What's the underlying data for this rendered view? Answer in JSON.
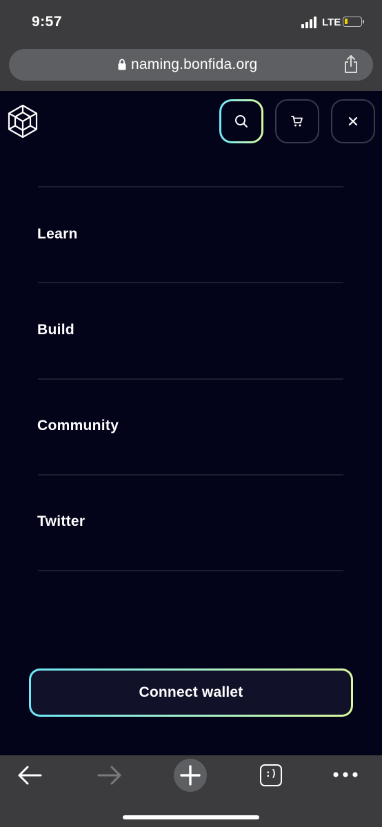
{
  "status_bar": {
    "time": "9:57",
    "network": "LTE",
    "signal_bars": 4,
    "battery_level": 0.2,
    "battery_color": "#f5d000"
  },
  "browser": {
    "url": "naming.bonfida.org",
    "lock_icon": "lock-icon",
    "share_icon": "share-icon"
  },
  "header": {
    "logo_icon": "cube-logo-icon",
    "search_icon": "search-icon",
    "cart_icon": "cart-icon",
    "close_icon": "close-icon",
    "accent_gradient": [
      "#6ee7f7",
      "#d9f99d"
    ]
  },
  "menu": {
    "items": [
      {
        "label": "Learn"
      },
      {
        "label": "Build"
      },
      {
        "label": "Community"
      },
      {
        "label": "Twitter"
      }
    ]
  },
  "connect_wallet": {
    "label": "Connect wallet"
  },
  "toolbar": {
    "back_icon": "back-arrow-icon",
    "forward_icon": "forward-arrow-icon",
    "new_tab_icon": "plus-icon",
    "tabs_icon": "tabs-smiley-icon",
    "tabs_label": ":)",
    "more_icon": "more-dots-icon"
  },
  "colors": {
    "background": "#03031a",
    "chrome": "#3c3c3e",
    "divider": "#1d1e30"
  }
}
